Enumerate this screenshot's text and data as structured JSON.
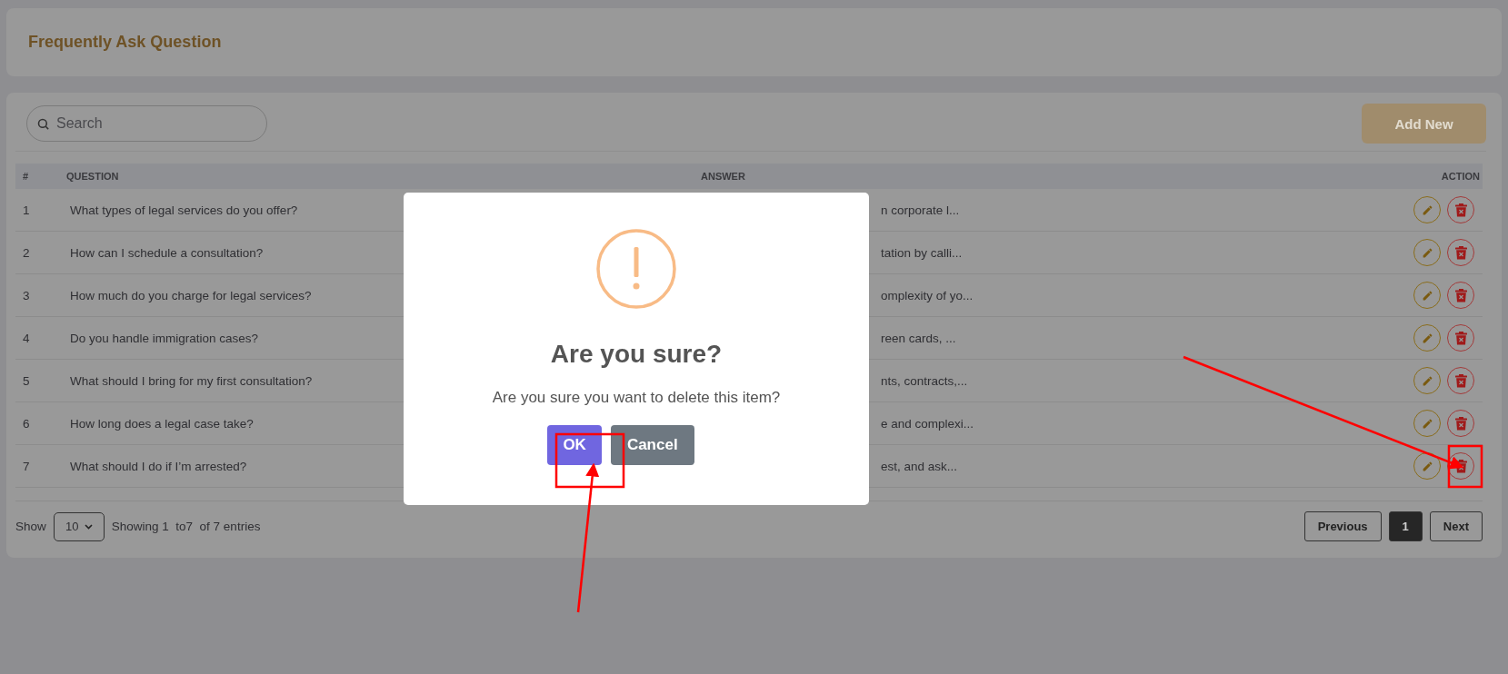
{
  "header": {
    "title": "Frequently Ask Question"
  },
  "toolbar": {
    "search_placeholder": "Search",
    "add_button": "Add New"
  },
  "table": {
    "columns": [
      "#",
      "QUESTION",
      "ANSWER",
      "ACTION"
    ],
    "rows": [
      {
        "index": "1",
        "question": "What types of legal services do you offer?",
        "answer": "n corporate l..."
      },
      {
        "index": "2",
        "question": "How can I schedule a consultation?",
        "answer": "tation by calli..."
      },
      {
        "index": "3",
        "question": "How much do you charge for legal services?",
        "answer": "omplexity of yo..."
      },
      {
        "index": "4",
        "question": "Do you handle immigration cases?",
        "answer": "reen cards, ..."
      },
      {
        "index": "5",
        "question": "What should I bring for my first consultation?",
        "answer": "nts, contracts,..."
      },
      {
        "index": "6",
        "question": "How long does a legal case take?",
        "answer": "e and complexi..."
      },
      {
        "index": "7",
        "question": "What should I do if I’m arrested?",
        "answer": "est, and ask..."
      }
    ]
  },
  "footer": {
    "show_label": "Show",
    "page_size": "10",
    "info": "Showing 1  to7  of 7 entries",
    "pagination": [
      {
        "label": "Previous",
        "selected": false
      },
      {
        "label": "1",
        "selected": true
      },
      {
        "label": "Next",
        "selected": false
      }
    ]
  },
  "dialog": {
    "title": "Are you sure?",
    "message": "Are you sure you want to delete this item?",
    "buttons": [
      {
        "label": "OK",
        "kind": "confirm"
      },
      {
        "label": "Cancel",
        "kind": "cancel"
      }
    ]
  }
}
